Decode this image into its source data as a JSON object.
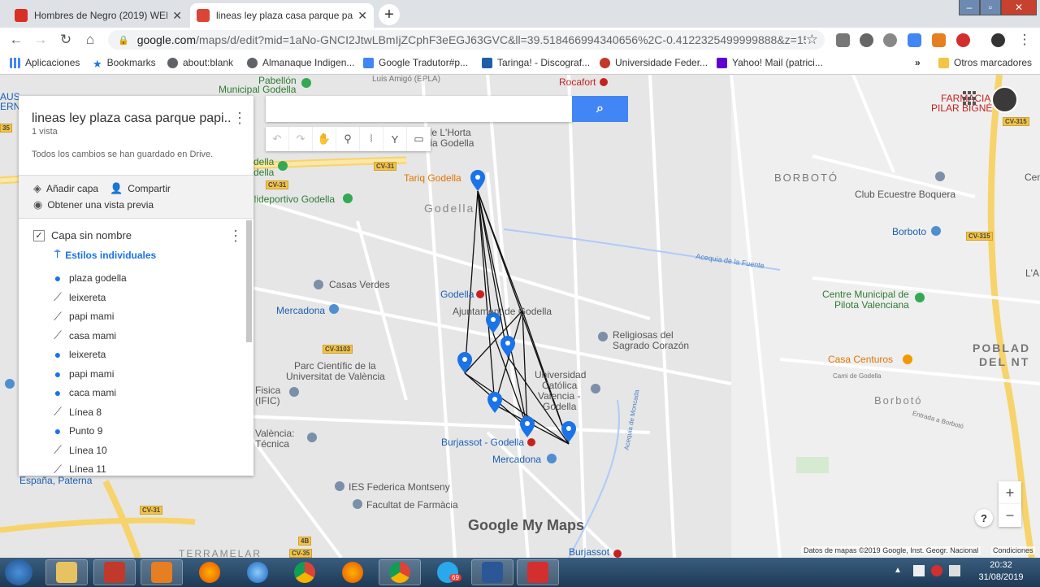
{
  "browser": {
    "tabs": [
      {
        "title": "Hombres de Negro (2019) WEB-(",
        "close": "✕",
        "favicon_color": "#d93025"
      },
      {
        "title": "lineas ley plaza casa parque papi",
        "close": "✕",
        "favicon_color": "#db4437"
      }
    ],
    "new_tab": "+",
    "window_buttons": [
      "–",
      "▫",
      "✕"
    ],
    "url_host": "google.com",
    "url_path": "/maps/d/edit?mid=1aNo-GNCI2JtwLBmIjZCphF3eEGJ63GVC&ll=39.518466994340656%2C-0.4122325499999888&z=15",
    "star": "☆",
    "menu": "⋮"
  },
  "bookmarks": {
    "items": [
      {
        "label": "Aplicaciones",
        "color": "#4285f4"
      },
      {
        "label": "Bookmarks",
        "color": "#1a73e8"
      },
      {
        "label": "about:blank",
        "color": "#5f6368"
      },
      {
        "label": "Almanaque Indigen...",
        "color": "#5f6368"
      },
      {
        "label": "Google Tradutor#p...",
        "color": "#4285f4"
      },
      {
        "label": "Taringa! - Discograf...",
        "color": "#1f5fa8"
      },
      {
        "label": "Universidade Feder...",
        "color": "#c0392b"
      },
      {
        "label": "Yahoo! Mail (patrici...",
        "color": "#5f01d1"
      }
    ],
    "more": "»",
    "other": "Otros marcadores"
  },
  "panel": {
    "title": "lineas ley plaza casa parque papi...",
    "views": "1 vista",
    "saved": "Todos los cambios se han guardado en Drive.",
    "add_layer": "Añadir capa",
    "share": "Compartir",
    "preview": "Obtener una vista previa",
    "layer_name": "Capa sin nombre",
    "styles": "Estilos individuales",
    "items": [
      {
        "label": "plaza godella",
        "type": "point"
      },
      {
        "label": "leixereta",
        "type": "line"
      },
      {
        "label": "papi mami",
        "type": "line"
      },
      {
        "label": "casa mami",
        "type": "line"
      },
      {
        "label": "leixereta",
        "type": "point"
      },
      {
        "label": "papi mami",
        "type": "point"
      },
      {
        "label": "caca mami",
        "type": "point"
      },
      {
        "label": "Línea 8",
        "type": "line"
      },
      {
        "label": "Punto 9",
        "type": "point"
      },
      {
        "label": "Línea 10",
        "type": "line"
      },
      {
        "label": "Línea 11",
        "type": "line"
      }
    ]
  },
  "map": {
    "labels": [
      {
        "text": "Municipal Godella"
      },
      {
        "text": "Rocafort"
      },
      {
        "text": "Tariq Godella"
      },
      {
        "text": "Godella"
      },
      {
        "text": "olideportivo Godella"
      },
      {
        "text": "Casas Verdes"
      },
      {
        "text": "Mercadona"
      },
      {
        "text": "Godella"
      },
      {
        "text": "Ajuntament de Godella"
      },
      {
        "text": "Religiosas del"
      },
      {
        "text": "Sagrado Corazón"
      },
      {
        "text": "Parc Científic de la"
      },
      {
        "text": "Universitat de València"
      },
      {
        "text": "Universidad"
      },
      {
        "text": "Católica"
      },
      {
        "text": "Valencia -"
      },
      {
        "text": "Godella"
      },
      {
        "text": "Burjassot - Godella"
      },
      {
        "text": "Mercadona"
      },
      {
        "text": "IES Federica Montseny"
      },
      {
        "text": "Facultat de Farmàcia"
      },
      {
        "text": "BORBOTÓ"
      },
      {
        "text": "Club Ecuestre Boquera"
      },
      {
        "text": "Borboto"
      },
      {
        "text": "Centre Municipal de"
      },
      {
        "text": "Pilota Valenciana"
      },
      {
        "text": "Casa Centuros"
      },
      {
        "text": "Borbotó"
      },
      {
        "text": "POBLAD"
      },
      {
        "text": "DEL NT"
      },
      {
        "text": "FARMACIA"
      },
      {
        "text": "PILAR BIGNÉ"
      },
      {
        "text": "España, Paterna"
      },
      {
        "text": "Burjassot"
      },
      {
        "text": "Acequia de la Fuente"
      },
      {
        "text": "Fisica"
      },
      {
        "text": "(IFIC)"
      },
      {
        "text": "València:"
      },
      {
        "text": "Técnica"
      },
      {
        "text": "TERRAMELAR"
      },
      {
        "text": "Luis Amigó (EPLA)"
      },
      {
        "text": "Pabellón"
      },
      {
        "text": "rio de L'Horta"
      },
      {
        "text": "Albia Godella"
      },
      {
        "text": "della"
      },
      {
        "text": "della"
      },
      {
        "text": "Cem"
      },
      {
        "text": "L'A"
      },
      {
        "text": "Cami de Godella"
      },
      {
        "text": "Entrada a Borbotó"
      },
      {
        "text": "AUS"
      },
      {
        "text": "ERN"
      },
      {
        "text": "Acequia de Moncada"
      }
    ],
    "roadsigns": [
      {
        "text": "CV-31"
      },
      {
        "text": "CV-31"
      },
      {
        "text": "CV-3103"
      },
      {
        "text": "CV-315"
      },
      {
        "text": "CV-315"
      },
      {
        "text": "CV-31"
      },
      {
        "text": "CV-35"
      },
      {
        "text": "4B"
      },
      {
        "text": "35"
      }
    ],
    "logo": "Google My Maps",
    "attribution": "Datos de mapas ©2019 Google, Inst. Geogr. Nacional",
    "terms": "Condiciones",
    "zoom_in": "+",
    "zoom_out": "−",
    "help": "?"
  },
  "taskbar": {
    "time": "20:32",
    "date": "31/08/2019",
    "telegram_badge": "69"
  }
}
